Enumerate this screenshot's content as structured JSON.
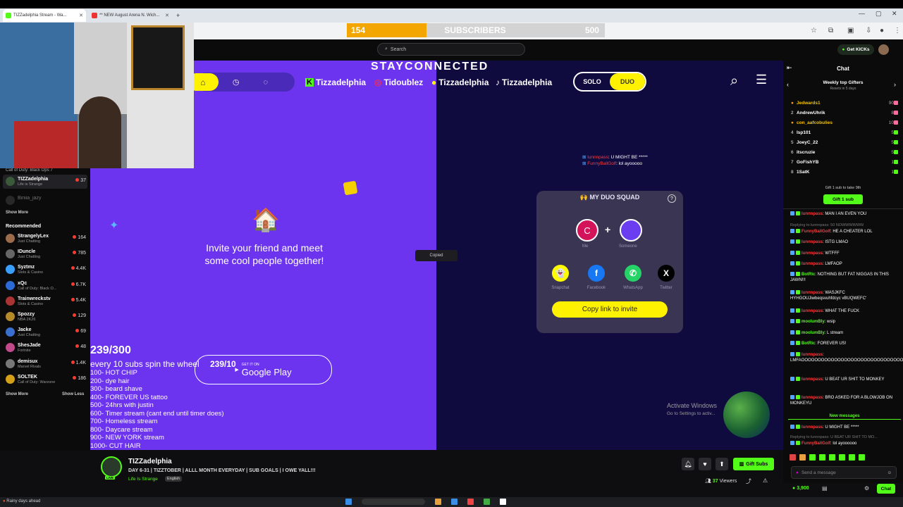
{
  "browser": {
    "tabs": [
      {
        "label": "TIZZadelphia Stream - Wa...",
        "color": "#53fc18"
      },
      {
        "label": "** NEW August Arena N. Wich...",
        "color": "#e33"
      }
    ],
    "subscriber_goal": {
      "current": "154",
      "label": "SUBSCRIBERS",
      "target": "500",
      "progress": 0.308
    }
  },
  "kick": {
    "search_placeholder": "Search",
    "get_kicks_label": "Get KICKs",
    "following": [
      {
        "name": "Call of Duty: Black Ops 7",
        "game": "",
        "viewers": ""
      },
      {
        "name": "TIZZadelphia",
        "game": "Life is Strange",
        "viewers": "37"
      },
      {
        "name": "Biniia_jazy",
        "game": "",
        "viewers": ""
      }
    ],
    "show_more_1": "Show More",
    "recommended_title": "Recommended",
    "recommended": [
      {
        "name": "StrangelyLex",
        "game": "Just Chatting",
        "viewers": "164",
        "color": "#9b6b4a"
      },
      {
        "name": "IDuncle",
        "game": "Just Chatting",
        "viewers": "785",
        "color": "#666"
      },
      {
        "name": "Syztmz",
        "game": "Slots & Casino",
        "viewers": "4.4K",
        "color": "#3aa0ff"
      },
      {
        "name": "xQc",
        "game": "Call of Duty: Black O...",
        "viewers": "6.7K",
        "color": "#2c6bd6"
      },
      {
        "name": "Trainwreckstv",
        "game": "Slots & Casino",
        "viewers": "5.4K",
        "color": "#a33"
      },
      {
        "name": "Spozzy",
        "game": "NBA 2K26",
        "viewers": "129",
        "color": "#b58b2a"
      },
      {
        "name": "Jacke",
        "game": "Just Chatting",
        "viewers": "69",
        "color": "#3a6fd0"
      },
      {
        "name": "ShesJade",
        "game": "Fortnite",
        "viewers": "48",
        "color": "#c04a8a"
      },
      {
        "name": "demisux",
        "game": "Marvel Rivals",
        "viewers": "1.4K",
        "color": "#777"
      },
      {
        "name": "SOLTEK",
        "game": "Call of Duty: Warzone",
        "viewers": "186",
        "color": "#d4a017"
      }
    ],
    "show_more_2": "Show More",
    "show_less": "Show Less"
  },
  "overlay": {
    "stay_connected": "STAYCONNECTED",
    "socials": [
      {
        "platform": "kick",
        "handle": "Tizzadelphia",
        "badge": "K"
      },
      {
        "platform": "instagram",
        "handle": "Tidoublez",
        "badge": "◎"
      },
      {
        "platform": "snapchat",
        "handle": "Tizzadelphia",
        "badge": "●"
      },
      {
        "platform": "tiktok",
        "handle": "Tizzadelphia",
        "badge": "♪"
      }
    ],
    "mode_solo": "SOLO",
    "mode_duo": "DUO",
    "invite_text_1": "Invite your friend and meet",
    "invite_text_2": "some cool people together!",
    "copied": "Copied",
    "goal_count": "239/300",
    "goal_spin": "every 10 subs spin the wheel",
    "goal_spin_count": "239/10",
    "google_play_small": "GET IT ON",
    "google_play": "Google Play",
    "goals": [
      "100- HOT CHIP",
      "200- dye hair",
      "300- beard shave",
      "400- FOREVER US tattoo",
      "500- 24hrs with justin",
      "600- Timer stream (cant end until timer does)",
      "700- Homeless stream",
      "800- Daycare stream",
      "900- NEW YORK stream",
      "1000- CUT HAIR"
    ],
    "overlay_chat": [
      {
        "user": "lunnnpass",
        "text": ": U MIGHT BE *****"
      },
      {
        "user": "FunnyBallGolf",
        "text": ": lol ayooooo"
      }
    ],
    "duo": {
      "title": "MY DUO SQUAD",
      "me_initial": "C",
      "me_label": "Me",
      "someone_label": "Someone",
      "share": [
        {
          "label": "Snapchat",
          "glyph": "👻",
          "color": "#fffc00"
        },
        {
          "label": "Facebook",
          "glyph": "f",
          "color": "#1877f2"
        },
        {
          "label": "WhatsApp",
          "glyph": "✆",
          "color": "#25d366"
        },
        {
          "label": "Twitter",
          "glyph": "X",
          "color": "#000000"
        }
      ],
      "copy_button": "Copy link to invite"
    },
    "activate_1": "Activate Windows",
    "activate_2": "Go to Settings to activ..."
  },
  "chat": {
    "title": "Chat",
    "top_gifters_title": "Weekly top Gifters",
    "top_gifters_sub": "Resets in 5 days",
    "gifters": [
      {
        "rank": "1",
        "name": "Jedwards1",
        "count": "90",
        "gold": true
      },
      {
        "rank": "2",
        "name": "AndrewUhrik",
        "count": "8",
        "gold": false
      },
      {
        "rank": "3",
        "name": "con_aafcobulies",
        "count": "10",
        "gold": true
      },
      {
        "rank": "4",
        "name": "Isp101",
        "count": "5",
        "gold": false
      },
      {
        "rank": "5",
        "name": "JoeyC_22",
        "count": "5",
        "gold": false
      },
      {
        "rank": "6",
        "name": "itscruzie",
        "count": "5",
        "gold": false
      },
      {
        "rank": "7",
        "name": "GoFishYB",
        "count": "1",
        "gold": false
      },
      {
        "rank": "8",
        "name": "1SatK",
        "count": "1",
        "gold": false
      }
    ],
    "gift_promo": "Gift 1 sub to take 9th",
    "gift_button": "Gift 1 sub",
    "messages": [
      {
        "user": "lunnnpass",
        "text": ": MAN I AN EVEN YOU",
        "ucls": "u"
      },
      {
        "user": "Replying to lunnnpass: 50 NOWWWWWW",
        "text": "",
        "ucls": "reply"
      },
      {
        "user": "FunnyBallGolf",
        "text": ": HE A CHEATER LOL",
        "ucls": "u"
      },
      {
        "user": "lunnnpass",
        "text": ": ISTG LMAO",
        "ucls": "u"
      },
      {
        "user": "lunnnpass",
        "text": ": WTFFF",
        "ucls": "u"
      },
      {
        "user": "lunnnpass",
        "text": ": LMFAOP",
        "ucls": "u"
      },
      {
        "user": "BotRic",
        "text": ": NOTHING BUT FAT NIGGAS IN THIS JAWN!!!",
        "ucls": "g"
      },
      {
        "user": "lunnnpass",
        "text": ": WASJKFC HYHGOUJiwbeqsvuhfdcyc vBUQWEFC'",
        "ucls": "u"
      },
      {
        "user": "lunnnpass",
        "text": ": WHAT THE FUCK",
        "ucls": "u"
      },
      {
        "user": "moolumBly",
        "text": ": wsip",
        "ucls": "g"
      },
      {
        "user": "moolumBly",
        "text": ": L stream",
        "ucls": "g"
      },
      {
        "user": "BotRic",
        "text": ": FOREVER US!",
        "ucls": "g"
      },
      {
        "user": "lunnnpass",
        "text": ": LMFAOOOOOOOOOOOOOOOOOOOOOOOOOOOOOOOOOOOOOOOO",
        "ucls": "u"
      },
      {
        "user": "lunnnpass",
        "text": ": U BEAT UR SHIT TO MONKEY",
        "ucls": "u"
      },
      {
        "user": "lunnnpass",
        "text": ": BRO ASKED FOR A BLOWJOB ON MONKEYU",
        "ucls": "u"
      }
    ],
    "new_messages": "New messages",
    "after": [
      {
        "user": "lunnnpass",
        "text": ": U MIGHT BE *****"
      },
      {
        "user": "Replying to lunnnpass: U BEAT UR SHIT TO MO...",
        "text": ""
      },
      {
        "user": "FunnyBallGolf",
        "text": ": lol ayoooooo"
      }
    ],
    "input_placeholder": "Send a message",
    "kicks_balance": "3,900",
    "chat_button": "Chat"
  },
  "channel": {
    "name": "TIZZadelphia",
    "title": "DAY 6-31 | TIZZTOBER | ALLL MONTH EVERYDAY | SUB GOALS | I OWE YALL!!!",
    "category": "Life Is Strange",
    "language": "English",
    "live_badge": "LIVE",
    "gift_subs": "Gift Subs",
    "viewers_count": "37",
    "viewers_label": "Viewers"
  },
  "taskbar": {
    "weather": "Rainy days ahead"
  }
}
